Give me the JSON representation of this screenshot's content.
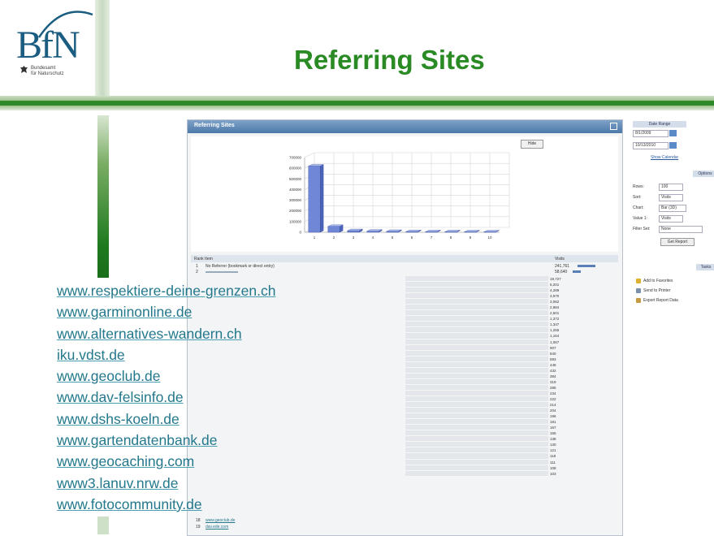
{
  "logo": {
    "text": "BfN",
    "subtitle_line1": "Bundesamt",
    "subtitle_line2": "für Naturschutz"
  },
  "slide": {
    "title": "Referring Sites"
  },
  "panel": {
    "title": "Referring Sites",
    "hide_button": "Hide",
    "table_header_name": "Rank Item",
    "table_header_visits": "Visits",
    "row1_rank": "1",
    "row1_name": "No Referrer (bookmark or direct entry)",
    "row1_visits": "241,761",
    "row2_rank": "2",
    "row2_visits": "58,640",
    "bottom_rows": [
      {
        "rank": "18",
        "name": "www.geoclub.de",
        "visits": ""
      },
      {
        "rank": "19",
        "name": "dav.ede.com",
        "visits": ""
      }
    ]
  },
  "chart_data": {
    "type": "bar",
    "categories": [
      "1",
      "2",
      "3",
      "4",
      "5",
      "6",
      "7",
      "8",
      "9",
      "10"
    ],
    "values": [
      620000,
      55000,
      15000,
      10000,
      8000,
      6000,
      5000,
      4500,
      4000,
      3500
    ],
    "ylim": [
      0,
      700000
    ],
    "yticks": [
      "700000",
      "600000",
      "500000",
      "400000",
      "300000",
      "200000",
      "100000",
      "0"
    ],
    "grid": true,
    "bar_color": "#6f87d6"
  },
  "visits_values": [
    "19,727",
    "5,201",
    "4,289",
    "3,970",
    "3,062",
    "2,984",
    "2,501",
    "1,372",
    "1,347",
    "1,255",
    "1,164",
    "1,067",
    "907",
    "840",
    "593",
    "448",
    "432",
    "384",
    "319",
    "285",
    "234",
    "222",
    "214",
    "204",
    "196",
    "181",
    "167",
    "155",
    "138",
    "130",
    "121",
    "118",
    "111",
    "108",
    "103"
  ],
  "sidebar": {
    "date_range_label": "Date Range",
    "start_date": "8/1/2009",
    "end_date": "10/13/2010",
    "show_calendar": "Show Calendar",
    "options_tab": "Options",
    "rows_label": "Rows:",
    "rows_value": "100",
    "sort_label": "Sort:",
    "sort_value": "Visits",
    "chart_label": "Chart:",
    "chart_value": "Bar (3D)",
    "value1_label": "Value 1:",
    "value1_value": "Visits",
    "filter_label": "Filter Set:",
    "filter_value": "None",
    "get_report": "Get Report",
    "tasks_tab": "Tasks",
    "task1": "Add to Favorites",
    "task2": "Send to Printer",
    "task3": "Export Report Data"
  },
  "links": [
    "www.respektiere-deine-grenzen.ch",
    "www.garminonline.de",
    "www.alternatives-wandern.ch",
    "iku.vdst.de",
    "www.geoclub.de",
    "www.dav-felsinfo.de",
    "www.dshs-koeln.de",
    "www.gartendatenbank.de",
    "www.geocaching.com",
    "www3.lanuv.nrw.de",
    "www.fotocommunity.de"
  ]
}
